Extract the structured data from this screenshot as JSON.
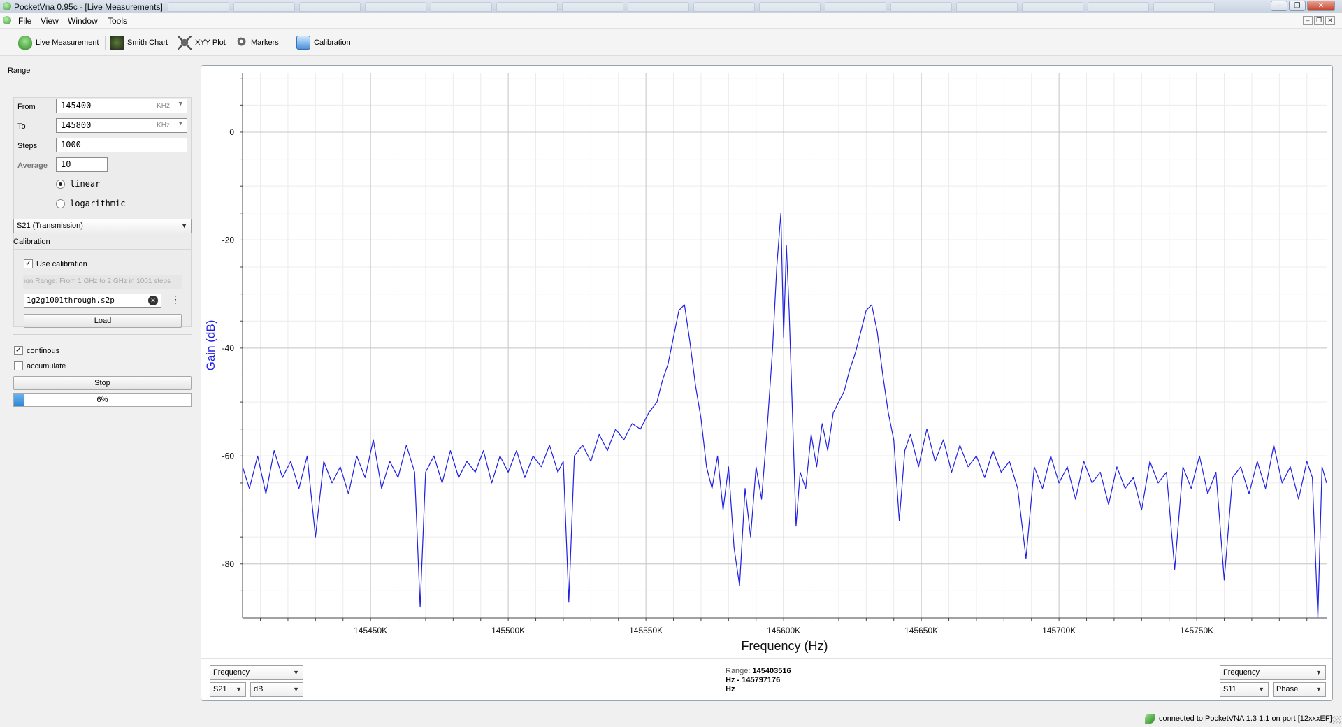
{
  "window": {
    "title": "PocketVna 0.95c - [Live Measurements]"
  },
  "menu": [
    "File",
    "View",
    "Window",
    "Tools"
  ],
  "toolbar": {
    "live": "Live Measurement",
    "smith": "Smith Chart",
    "xyy": "XYY Plot",
    "markers": "Markers",
    "calibration": "Calibration"
  },
  "range": {
    "heading": "Range",
    "from_label": "From",
    "from_value": "145400",
    "from_unit": "KHz",
    "to_label": "To",
    "to_value": "145800",
    "to_unit": "KHz",
    "steps_label": "Steps",
    "steps_value": "1000",
    "average_label": "Average",
    "average_value": "10",
    "scale_options": [
      "linear",
      "logarithmic"
    ],
    "scale_selected": "linear"
  },
  "param_select": "S21 (Transmission)",
  "calibration": {
    "heading": "Calibration",
    "use_label": "Use calibration",
    "use_checked": true,
    "range_text": "ion Range: From 1 GHz to 2 GHz in 1001 steps",
    "file": "1g2g1001through.s2p",
    "load_label": "Load"
  },
  "options": {
    "continous_label": "continous",
    "continous_checked": true,
    "accumulate_label": "accumulate",
    "accumulate_checked": false,
    "stop_label": "Stop",
    "progress_text": "6%",
    "progress_value": 0.06
  },
  "chart_bottom": {
    "left_axis_select": "Frequency",
    "left_param": "S21",
    "left_unit": "dB",
    "range_label": "Range:",
    "range_start": "145403516",
    "range_line2": "Hz - 145797176",
    "range_line3": "Hz",
    "right_axis_select": "Frequency",
    "right_param": "S11",
    "right_unit": "Phase"
  },
  "status": {
    "text": "connected to PocketVNA 1.3 1.1 on port [12xxxEF]"
  },
  "colors": {
    "trace": "#1f1fe6",
    "grid_major": "#c8c8c8",
    "grid_minor": "#ececec",
    "ylabel": "#1f1fe6"
  },
  "chart_data": {
    "type": "line",
    "xlabel": "Frequency (Hz)",
    "ylabel": "Gain (dB)",
    "xlim": [
      145403516,
      145797176
    ],
    "ylim": [
      -90,
      11
    ],
    "xticks": [
      145450000,
      145500000,
      145550000,
      145600000,
      145650000,
      145700000,
      145750000
    ],
    "xtick_labels": [
      "145450K",
      "145500K",
      "145550K",
      "145600K",
      "145650K",
      "145700K",
      "145750K"
    ],
    "yticks": [
      0,
      -20,
      -40,
      -60,
      -80
    ],
    "ytick_labels": [
      "0",
      "-20",
      "-40",
      "-60",
      "-80"
    ],
    "grid": true,
    "series": [
      {
        "values": [
          [
            145403516,
            -62
          ],
          [
            145406000,
            -66
          ],
          [
            145409000,
            -60
          ],
          [
            145412000,
            -67
          ],
          [
            145415000,
            -59
          ],
          [
            145418000,
            -64
          ],
          [
            145421000,
            -61
          ],
          [
            145424000,
            -66
          ],
          [
            145427000,
            -60
          ],
          [
            145430000,
            -75
          ],
          [
            145433000,
            -61
          ],
          [
            145436000,
            -65
          ],
          [
            145439000,
            -62
          ],
          [
            145442000,
            -67
          ],
          [
            145445000,
            -60
          ],
          [
            145448000,
            -64
          ],
          [
            145451000,
            -57
          ],
          [
            145454000,
            -66
          ],
          [
            145457000,
            -61
          ],
          [
            145460000,
            -64
          ],
          [
            145463000,
            -58
          ],
          [
            145466000,
            -63
          ],
          [
            145468000,
            -88
          ],
          [
            145470000,
            -63
          ],
          [
            145473000,
            -60
          ],
          [
            145476000,
            -65
          ],
          [
            145479000,
            -59
          ],
          [
            145482000,
            -64
          ],
          [
            145485000,
            -61
          ],
          [
            145488000,
            -63
          ],
          [
            145491000,
            -59
          ],
          [
            145494000,
            -65
          ],
          [
            145497000,
            -60
          ],
          [
            145500000,
            -63
          ],
          [
            145503000,
            -59
          ],
          [
            145506000,
            -64
          ],
          [
            145509000,
            -60
          ],
          [
            145512000,
            -62
          ],
          [
            145515000,
            -58
          ],
          [
            145518000,
            -63
          ],
          [
            145520000,
            -61
          ],
          [
            145522000,
            -87
          ],
          [
            145524000,
            -60
          ],
          [
            145527000,
            -58
          ],
          [
            145530000,
            -61
          ],
          [
            145533000,
            -56
          ],
          [
            145536000,
            -59
          ],
          [
            145539000,
            -55
          ],
          [
            145542000,
            -57
          ],
          [
            145545000,
            -54
          ],
          [
            145548000,
            -55
          ],
          [
            145551000,
            -52
          ],
          [
            145554000,
            -50
          ],
          [
            145556000,
            -46
          ],
          [
            145558000,
            -43
          ],
          [
            145560000,
            -38
          ],
          [
            145562000,
            -33
          ],
          [
            145564000,
            -32
          ],
          [
            145566000,
            -39
          ],
          [
            145568000,
            -47
          ],
          [
            145570000,
            -53
          ],
          [
            145572000,
            -62
          ],
          [
            145574000,
            -66
          ],
          [
            145576000,
            -60
          ],
          [
            145578000,
            -70
          ],
          [
            145580000,
            -62
          ],
          [
            145582000,
            -77
          ],
          [
            145584000,
            -84
          ],
          [
            145586000,
            -66
          ],
          [
            145588000,
            -75
          ],
          [
            145590000,
            -62
          ],
          [
            145592000,
            -68
          ],
          [
            145594000,
            -55
          ],
          [
            145596000,
            -40
          ],
          [
            145597500,
            -25
          ],
          [
            145599000,
            -15
          ],
          [
            145600000,
            -38
          ],
          [
            145601000,
            -21
          ],
          [
            145602000,
            -33
          ],
          [
            145603000,
            -49
          ],
          [
            145604500,
            -73
          ],
          [
            145606000,
            -63
          ],
          [
            145608000,
            -66
          ],
          [
            145610000,
            -56
          ],
          [
            145612000,
            -62
          ],
          [
            145614000,
            -54
          ],
          [
            145616000,
            -59
          ],
          [
            145618000,
            -52
          ],
          [
            145620000,
            -50
          ],
          [
            145622000,
            -48
          ],
          [
            145624000,
            -44
          ],
          [
            145626000,
            -41
          ],
          [
            145628000,
            -37
          ],
          [
            145630000,
            -33
          ],
          [
            145632000,
            -32
          ],
          [
            145634000,
            -37
          ],
          [
            145636000,
            -45
          ],
          [
            145638000,
            -52
          ],
          [
            145640000,
            -57
          ],
          [
            145642000,
            -72
          ],
          [
            145644000,
            -59
          ],
          [
            145646000,
            -56
          ],
          [
            145649000,
            -62
          ],
          [
            145652000,
            -55
          ],
          [
            145655000,
            -61
          ],
          [
            145658000,
            -57
          ],
          [
            145661000,
            -63
          ],
          [
            145664000,
            -58
          ],
          [
            145667000,
            -62
          ],
          [
            145670000,
            -60
          ],
          [
            145673000,
            -64
          ],
          [
            145676000,
            -59
          ],
          [
            145679000,
            -63
          ],
          [
            145682000,
            -61
          ],
          [
            145685000,
            -66
          ],
          [
            145688000,
            -79
          ],
          [
            145691000,
            -62
          ],
          [
            145694000,
            -66
          ],
          [
            145697000,
            -60
          ],
          [
            145700000,
            -65
          ],
          [
            145703000,
            -62
          ],
          [
            145706000,
            -68
          ],
          [
            145709000,
            -61
          ],
          [
            145712000,
            -65
          ],
          [
            145715000,
            -63
          ],
          [
            145718000,
            -69
          ],
          [
            145721000,
            -62
          ],
          [
            145724000,
            -66
          ],
          [
            145727000,
            -64
          ],
          [
            145730000,
            -70
          ],
          [
            145733000,
            -61
          ],
          [
            145736000,
            -65
          ],
          [
            145739000,
            -63
          ],
          [
            145742000,
            -81
          ],
          [
            145745000,
            -62
          ],
          [
            145748000,
            -66
          ],
          [
            145751000,
            -60
          ],
          [
            145754000,
            -67
          ],
          [
            145757000,
            -63
          ],
          [
            145760000,
            -83
          ],
          [
            145763000,
            -64
          ],
          [
            145766000,
            -62
          ],
          [
            145769000,
            -67
          ],
          [
            145772000,
            -61
          ],
          [
            145775000,
            -66
          ],
          [
            145778000,
            -58
          ],
          [
            145781000,
            -65
          ],
          [
            145784000,
            -62
          ],
          [
            145787000,
            -68
          ],
          [
            145790000,
            -61
          ],
          [
            145792000,
            -64
          ],
          [
            145794000,
            -90
          ],
          [
            145795500,
            -62
          ],
          [
            145797176,
            -65
          ]
        ]
      }
    ]
  }
}
